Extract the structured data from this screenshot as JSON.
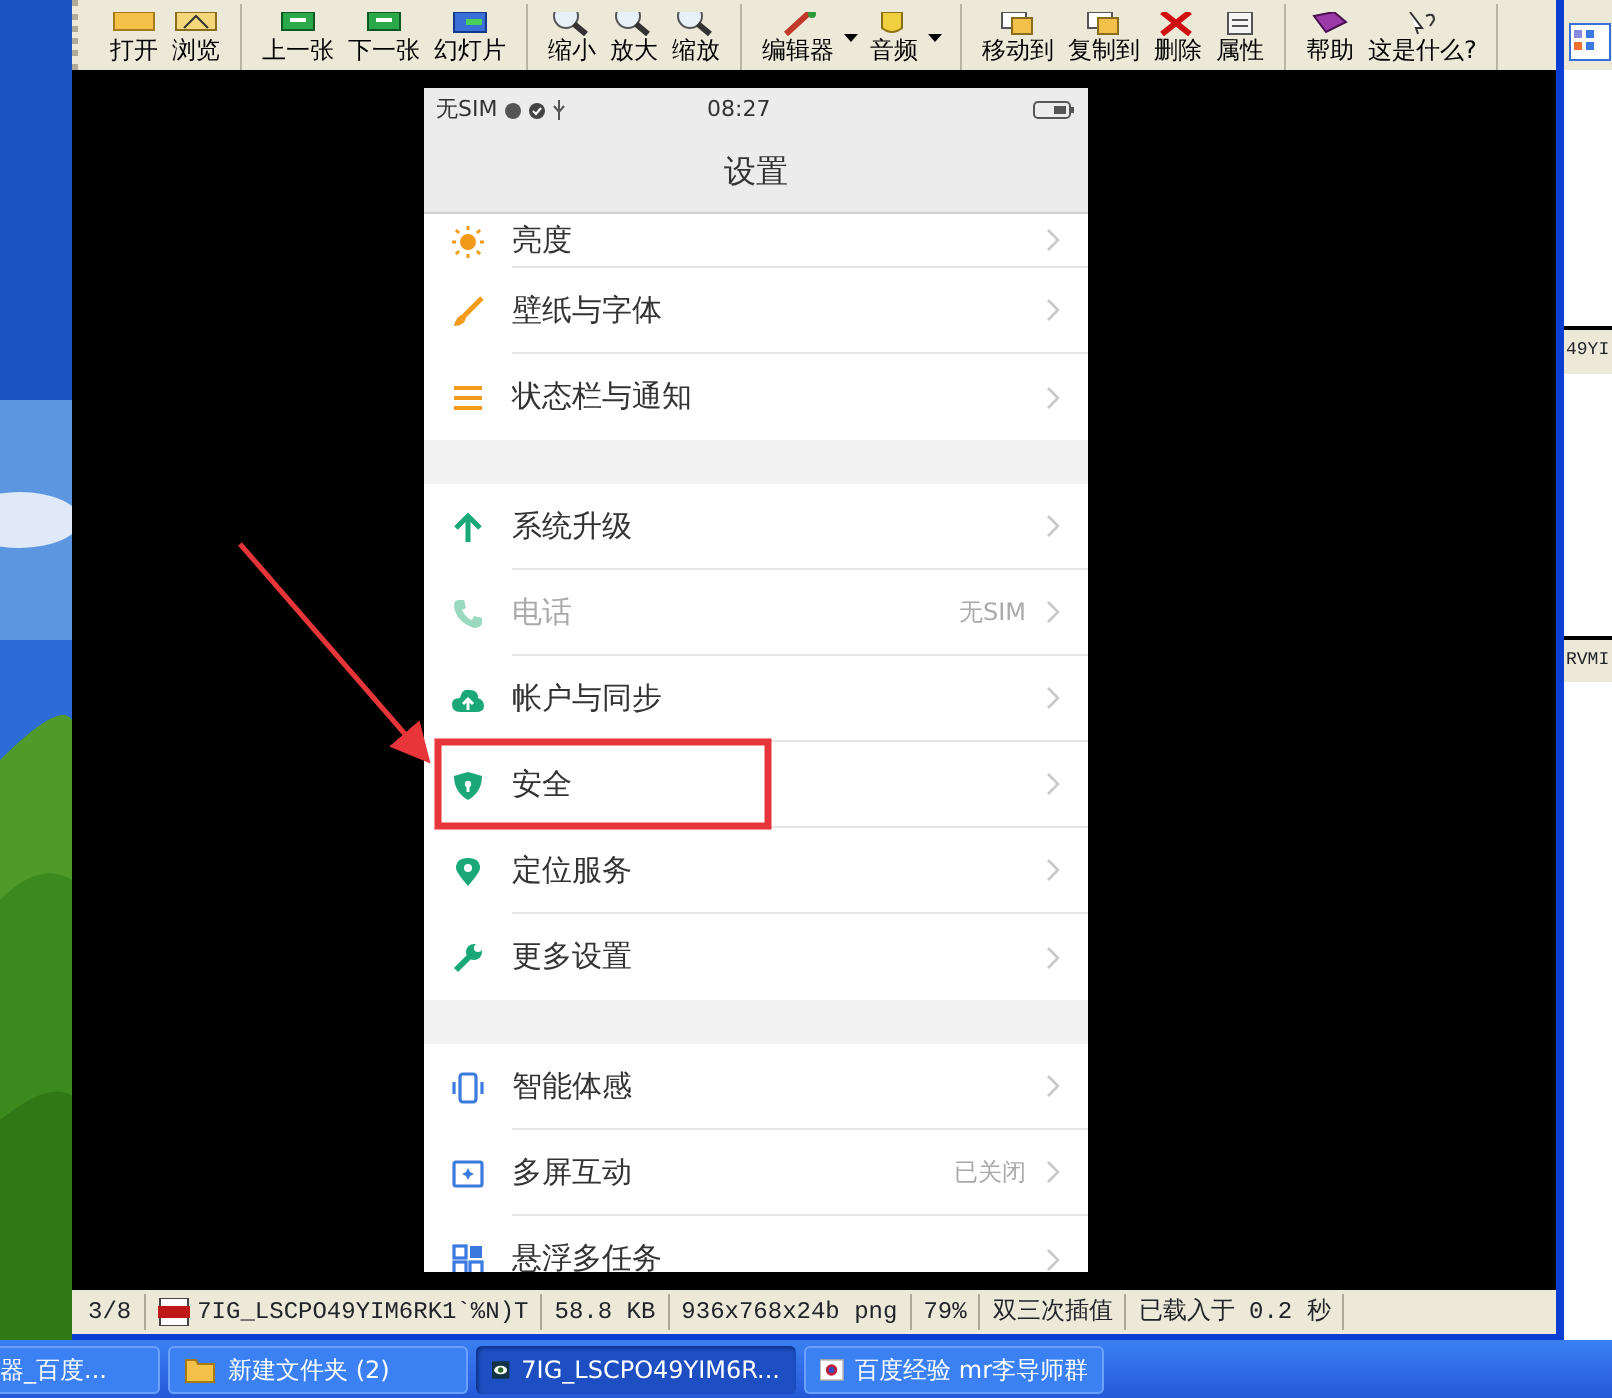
{
  "toolbar": {
    "groups": [
      [
        {
          "label": "打开",
          "dropdown": false
        },
        {
          "label": "浏览",
          "dropdown": false
        }
      ],
      [
        {
          "label": "上一张",
          "dropdown": false
        },
        {
          "label": "下一张",
          "dropdown": false
        },
        {
          "label": "幻灯片",
          "dropdown": false
        }
      ],
      [
        {
          "label": "缩小",
          "dropdown": false
        },
        {
          "label": "放大",
          "dropdown": false
        },
        {
          "label": "缩放",
          "dropdown": false
        }
      ],
      [
        {
          "label": "编辑器",
          "dropdown": true
        },
        {
          "label": "音频",
          "dropdown": true
        }
      ],
      [
        {
          "label": "移动到",
          "dropdown": false
        },
        {
          "label": "复制到",
          "dropdown": false
        },
        {
          "label": "删除",
          "dropdown": false
        },
        {
          "label": "属性",
          "dropdown": false
        }
      ],
      [
        {
          "label": "帮助",
          "dropdown": false
        },
        {
          "label": "这是什么?",
          "dropdown": false
        }
      ]
    ]
  },
  "phone": {
    "status": {
      "carrier": "无SIM",
      "time": "08:27"
    },
    "title": "设置",
    "sections": [
      [
        {
          "label": "亮度",
          "disabled": false
        },
        {
          "label": "壁纸与字体",
          "disabled": false
        },
        {
          "label": "状态栏与通知",
          "disabled": false
        }
      ],
      [
        {
          "label": "系统升级",
          "disabled": false
        },
        {
          "label": "电话",
          "value": "无SIM",
          "disabled": true
        },
        {
          "label": "帐户与同步",
          "disabled": false
        },
        {
          "label": "安全",
          "disabled": false
        },
        {
          "label": "定位服务",
          "disabled": false
        },
        {
          "label": "更多设置",
          "disabled": false
        }
      ],
      [
        {
          "label": "智能体感",
          "disabled": false
        },
        {
          "label": "多屏互动",
          "value": "已关闭",
          "disabled": false
        },
        {
          "label": "悬浮多任务",
          "disabled": false
        }
      ]
    ]
  },
  "status_bar": [
    "3/8",
    "7IG_LSCPO49YIM6RK1`%N)T",
    "58.8 KB",
    "936x768x24b png",
    "79%",
    "双三次插值",
    "已载入于 0.2 秒"
  ],
  "taskbar": [
    {
      "label": "器_百度...",
      "selected": false
    },
    {
      "label": "新建文件夹 (2)",
      "selected": false
    },
    {
      "label": "7IG_LSCPO49YIM6R...",
      "selected": true
    },
    {
      "label": "百度经验 mr李导师群",
      "selected": false
    }
  ],
  "side_window": [
    "49YI",
    "RVMI"
  ]
}
